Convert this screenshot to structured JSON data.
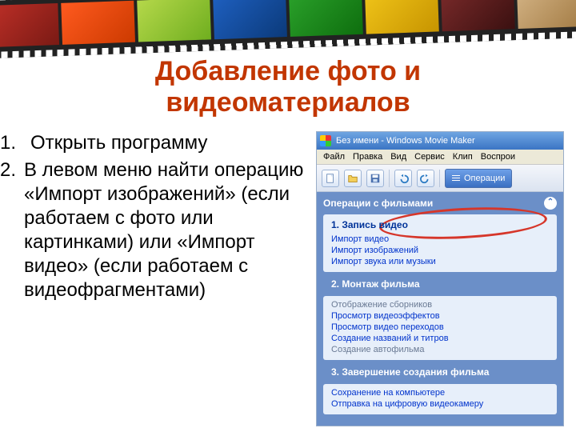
{
  "slide": {
    "title": "Добавление фото и видеоматериалов",
    "steps": [
      {
        "num": "1.",
        "text": "Открыть программу"
      },
      {
        "num": "2.",
        "text": "В левом меню найти операцию «Импорт изображений» (если работаем с фото или картинками) или «Импорт видео»  (если работаем с видеофрагментами)"
      }
    ]
  },
  "app": {
    "title": "Без имени - Windows Movie Maker",
    "menu": [
      "Файл",
      "Правка",
      "Вид",
      "Сервис",
      "Клип",
      "Воспрои"
    ],
    "toolbar": {
      "ops_label": "Операции"
    },
    "task_pane_title": "Операции с фильмами",
    "sections": [
      {
        "title": "1.  Запись видео",
        "links": [
          {
            "label": "Импорт видео",
            "muted": false
          },
          {
            "label": "Импорт изображений",
            "muted": false
          },
          {
            "label": "Импорт звука или музыки",
            "muted": false
          }
        ]
      },
      {
        "title": "2.  Монтаж фильма",
        "links": [
          {
            "label": "Отображение сборников",
            "muted": true
          },
          {
            "label": "Просмотр видеоэффектов",
            "muted": false
          },
          {
            "label": "Просмотр видео переходов",
            "muted": false
          },
          {
            "label": "Создание названий и титров",
            "muted": false
          },
          {
            "label": "Создание автофильма",
            "muted": true
          }
        ]
      },
      {
        "title": "3.  Завершение создания фильма",
        "links": [
          {
            "label": "Сохранение на компьютере",
            "muted": false
          },
          {
            "label": "Отправка на цифровую видеокамеру",
            "muted": false
          }
        ]
      }
    ]
  }
}
